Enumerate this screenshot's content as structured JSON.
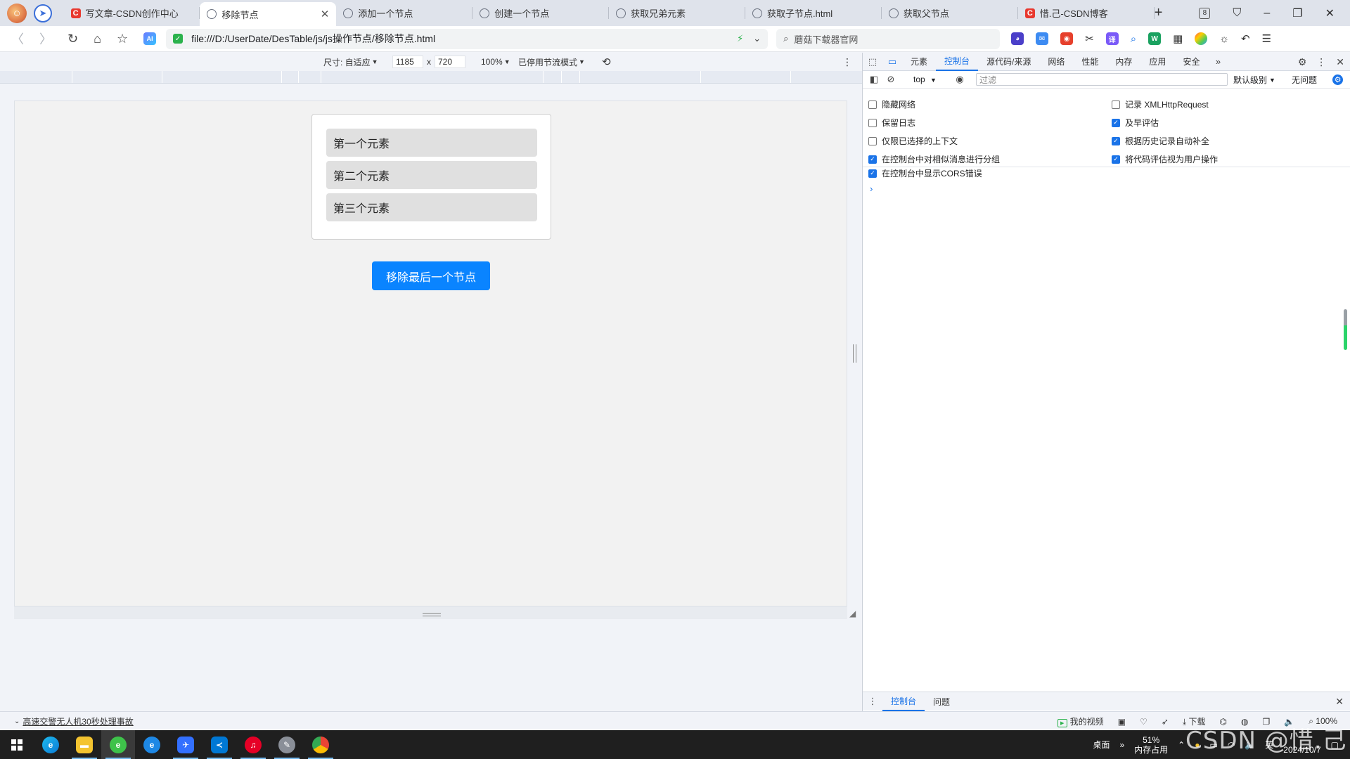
{
  "tabs": [
    {
      "title": "写文章-CSDN创作中心",
      "favicon": "csdn",
      "active": false
    },
    {
      "title": "移除节点",
      "favicon": "globe",
      "active": true
    },
    {
      "title": "添加一个节点",
      "favicon": "globe",
      "active": false
    },
    {
      "title": "创建一个节点",
      "favicon": "globe",
      "active": false
    },
    {
      "title": "获取兄弟元素",
      "favicon": "globe",
      "active": false
    },
    {
      "title": "获取子节点.html",
      "favicon": "globe",
      "active": false
    },
    {
      "title": "获取父节点",
      "favicon": "globe",
      "active": false
    },
    {
      "title": "惜.己-CSDN博客",
      "favicon": "csdn",
      "active": false
    }
  ],
  "tab_count": "8",
  "address": {
    "url": "file:///D:/UserDate/DesTable/js/js操作节点/移除节点.html",
    "search_placeholder": "蘑菇下载器官网"
  },
  "device_toolbar": {
    "dimensions_label": "尺寸: 自适应",
    "width": "1185",
    "times": "x",
    "height": "720",
    "zoom": "100%",
    "throttle": "已停用节流模式"
  },
  "page": {
    "items": [
      "第一个元素",
      "第二个元素",
      "第三个元素"
    ],
    "button_label": "移除最后一个节点"
  },
  "devtools": {
    "tabs": [
      "元素",
      "控制台",
      "源代码/来源",
      "网络",
      "性能",
      "内存",
      "应用",
      "安全"
    ],
    "active_tab": "控制台",
    "context": "top",
    "filter_placeholder": "过滤",
    "level": "默认级别",
    "issues": "无问题",
    "settings_left": [
      {
        "label": "隐藏网络",
        "checked": false
      },
      {
        "label": "保留日志",
        "checked": false
      },
      {
        "label": "仅限已选择的上下文",
        "checked": false
      },
      {
        "label": "在控制台中对相似消息进行分组",
        "checked": true
      },
      {
        "label": "在控制台中显示CORS错误",
        "checked": true
      }
    ],
    "settings_right": [
      {
        "label": "记录 XMLHttpRequest",
        "checked": false
      },
      {
        "label": "及早评估",
        "checked": true
      },
      {
        "label": "根据历史记录自动补全",
        "checked": true
      },
      {
        "label": "将代码评估视为用户操作",
        "checked": true
      }
    ],
    "drawer_tabs": [
      "控制台",
      "问题"
    ]
  },
  "statusbar": {
    "news": "高速交警无人机30秒处理事故",
    "my_video": "我的视频",
    "download": "下载",
    "zoom": "100%"
  },
  "taskbar": {
    "desktop": "桌面",
    "memory_percent": "51%",
    "memory_label": "内存占用",
    "ime": "英",
    "date": "2024/10/7"
  },
  "watermark": "CSDN @惜.己"
}
